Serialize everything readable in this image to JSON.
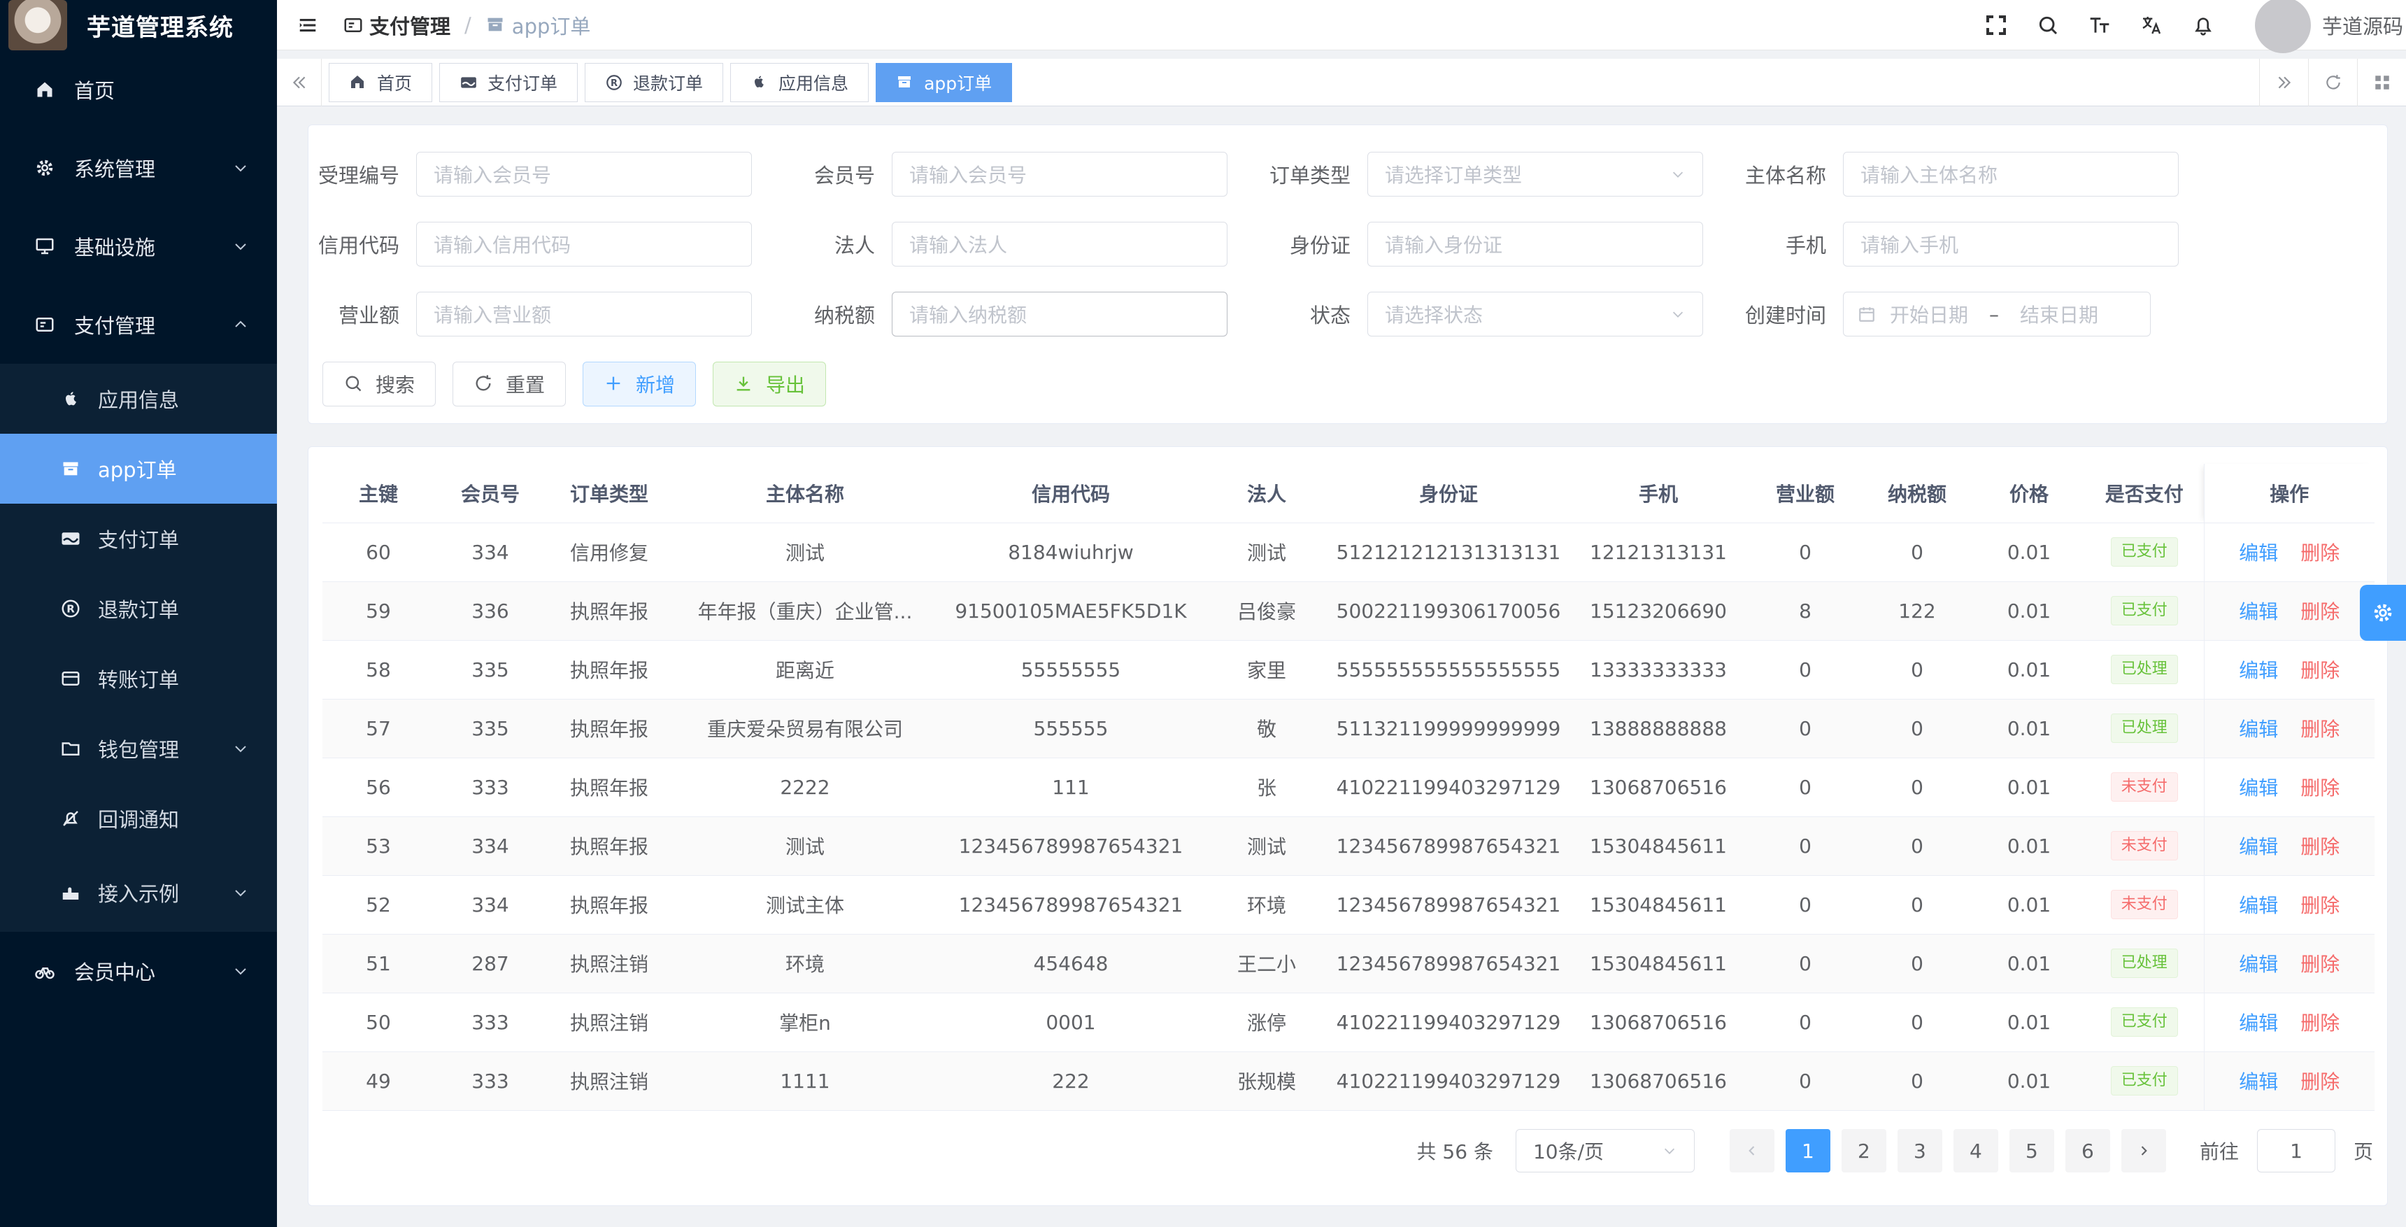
{
  "app": {
    "title": "芋道管理系统"
  },
  "sidebar": {
    "items": [
      {
        "label": "首页"
      },
      {
        "label": "系统管理"
      },
      {
        "label": "基础设施"
      },
      {
        "label": "支付管理"
      },
      {
        "label": "会员中心"
      }
    ],
    "pay_submenu": [
      {
        "label": "应用信息"
      },
      {
        "label": "app订单"
      },
      {
        "label": "支付订单"
      },
      {
        "label": "退款订单"
      },
      {
        "label": "转账订单"
      },
      {
        "label": "钱包管理"
      },
      {
        "label": "回调通知"
      },
      {
        "label": "接入示例"
      }
    ]
  },
  "navbar": {
    "breadcrumb": [
      "支付管理",
      "app订单"
    ],
    "user_name": "芋道源码"
  },
  "tags": [
    "首页",
    "支付订单",
    "退款订单",
    "应用信息",
    "app订单"
  ],
  "search": {
    "labels": {
      "accept_no": "受理编号",
      "member_no": "会员号",
      "order_type": "订单类型",
      "subject_name": "主体名称",
      "credit_code": "信用代码",
      "legal_person": "法人",
      "id_card": "身份证",
      "phone": "手机",
      "revenue": "营业额",
      "tax": "纳税额",
      "status": "状态",
      "create_time": "创建时间"
    },
    "placeholders": {
      "accept_no": "请输入会员号",
      "member_no": "请输入会员号",
      "order_type": "请选择订单类型",
      "subject_name": "请输入主体名称",
      "credit_code": "请输入信用代码",
      "legal_person": "请输入法人",
      "id_card": "请输入身份证",
      "phone": "请输入手机",
      "revenue": "请输入营业额",
      "tax": "请输入纳税额",
      "status": "请选择状态",
      "start_date": "开始日期",
      "end_date": "结束日期",
      "date_sep": "–"
    },
    "buttons": {
      "search": "搜索",
      "reset": "重置",
      "add": "新增",
      "export": "导出"
    }
  },
  "table": {
    "columns": [
      "主键",
      "会员号",
      "订单类型",
      "主体名称",
      "信用代码",
      "法人",
      "身份证",
      "手机",
      "营业额",
      "纳税额",
      "价格",
      "是否支付",
      "操作"
    ],
    "actions": {
      "edit": "编辑",
      "delete": "删除"
    },
    "rows": [
      [
        "60",
        "334",
        "信用修复",
        "测试",
        "8184wiuhrjw",
        "测试",
        "51212121213131313​1",
        "12121313131",
        "0",
        "0",
        "0.01",
        "已支付"
      ],
      [
        "59",
        "336",
        "执照年报",
        "年年报（重庆）企业管...",
        "91500105MAE5FK5D1K",
        "吕俊豪",
        "500221199306170056",
        "15123206690",
        "8",
        "122",
        "0.01",
        "已支付"
      ],
      [
        "58",
        "335",
        "执照年报",
        "距离近",
        "55555555",
        "家里",
        "555555555555555555",
        "13333333333",
        "0",
        "0",
        "0.01",
        "已处理"
      ],
      [
        "57",
        "335",
        "执照年报",
        "重庆爱朵贸易有限公司",
        "555555",
        "敬",
        "511321199999999999",
        "13888888888",
        "0",
        "0",
        "0.01",
        "已处理"
      ],
      [
        "56",
        "333",
        "执照年报",
        "2222",
        "111",
        "张",
        "410221199403297129",
        "13068706516",
        "0",
        "0",
        "0.01",
        "未支付"
      ],
      [
        "53",
        "334",
        "执照年报",
        "测试",
        "123456789987654321",
        "测试",
        "123456789987654321",
        "15304845611",
        "0",
        "0",
        "0.01",
        "未支付"
      ],
      [
        "52",
        "334",
        "执照年报",
        "测试主体",
        "123456789987654321",
        "环境",
        "123456789987654321",
        "15304845611",
        "0",
        "0",
        "0.01",
        "未支付"
      ],
      [
        "51",
        "287",
        "执照注销",
        "环境",
        "454648",
        "王二小",
        "123456789987654321",
        "15304845611",
        "0",
        "0",
        "0.01",
        "已处理"
      ],
      [
        "50",
        "333",
        "执照注销",
        "掌柜n",
        "0001",
        "涨停",
        "410221199403297129",
        "13068706516",
        "0",
        "0",
        "0.01",
        "已支付"
      ],
      [
        "49",
        "333",
        "执照注销",
        "1111",
        "222",
        "张规模",
        "410221199403297129",
        "13068706516",
        "0",
        "0",
        "0.01",
        "已支付"
      ]
    ]
  },
  "pagination": {
    "total": "共 56 条",
    "page_size": "10条/页",
    "pages": [
      "1",
      "2",
      "3",
      "4",
      "5",
      "6"
    ],
    "current": "1",
    "goto_prefix": "前往",
    "goto_value": "1",
    "goto_suffix": "页"
  },
  "colors": {
    "primary": "#409eff",
    "sidebar_bg": "#001529",
    "active_menu": "#5fa0f2",
    "success": "#67c23a",
    "danger": "#f56c6c"
  }
}
